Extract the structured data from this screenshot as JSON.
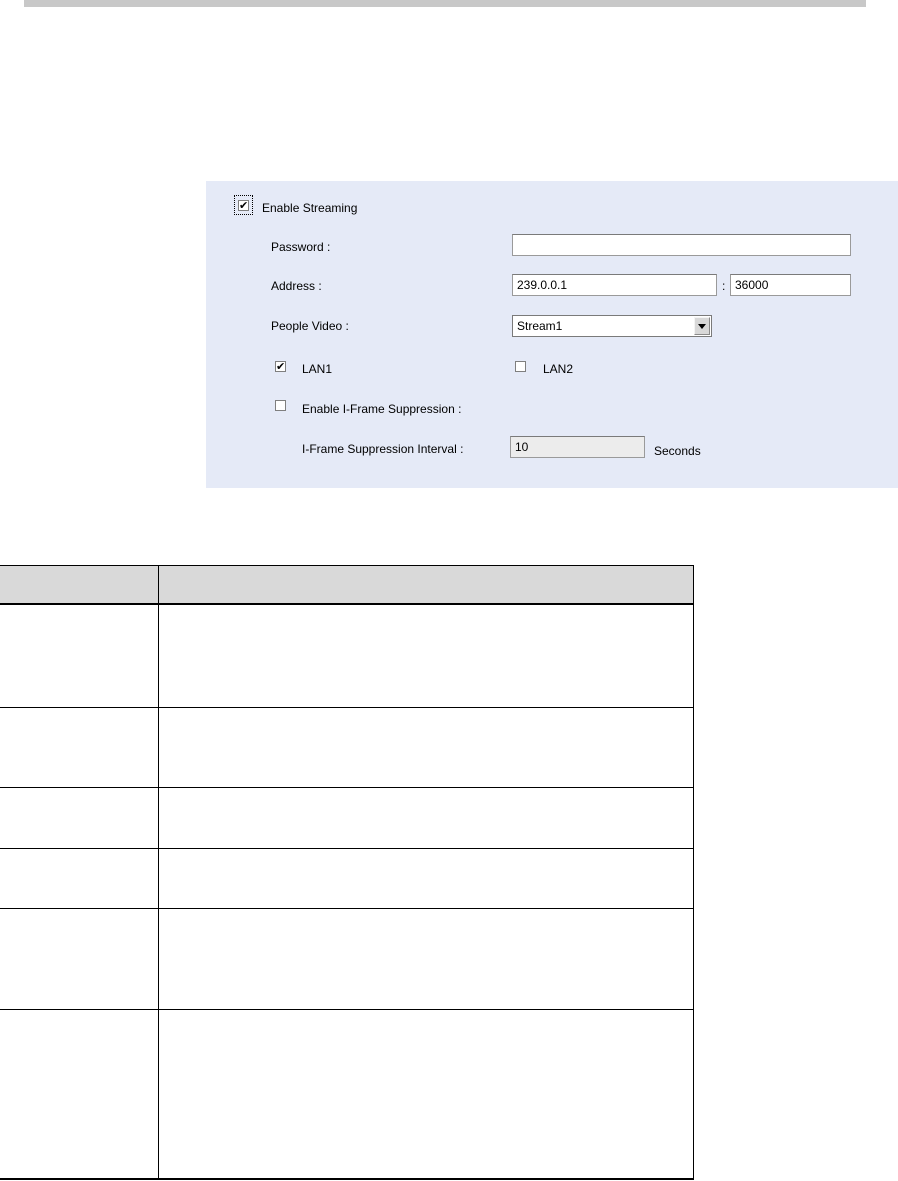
{
  "panel": {
    "enable_streaming": {
      "label": "Enable Streaming",
      "checked": true
    },
    "password": {
      "label": "Password :",
      "value": ""
    },
    "address": {
      "label": "Address :",
      "ip": "239.0.0.1",
      "separator": ":",
      "port": "36000"
    },
    "people_video": {
      "label": "People Video :",
      "selected": "Stream1"
    },
    "lan1": {
      "label": "LAN1",
      "checked": true
    },
    "lan2": {
      "label": "LAN2",
      "checked": false
    },
    "iframe_suppression": {
      "label": "Enable I-Frame Suppression :",
      "checked": false
    },
    "iframe_interval": {
      "label": "I-Frame Suppression Interval :",
      "value": "10",
      "unit": "Seconds"
    }
  },
  "table": {
    "headers": [
      "",
      ""
    ],
    "rows": [
      [
        "",
        ""
      ],
      [
        "",
        ""
      ],
      [
        "",
        ""
      ],
      [
        "",
        ""
      ],
      [
        "",
        ""
      ],
      [
        "",
        ""
      ]
    ]
  },
  "colors": {
    "panel_background": "#e5eaf7",
    "table_header_background": "#d9d9d9"
  }
}
